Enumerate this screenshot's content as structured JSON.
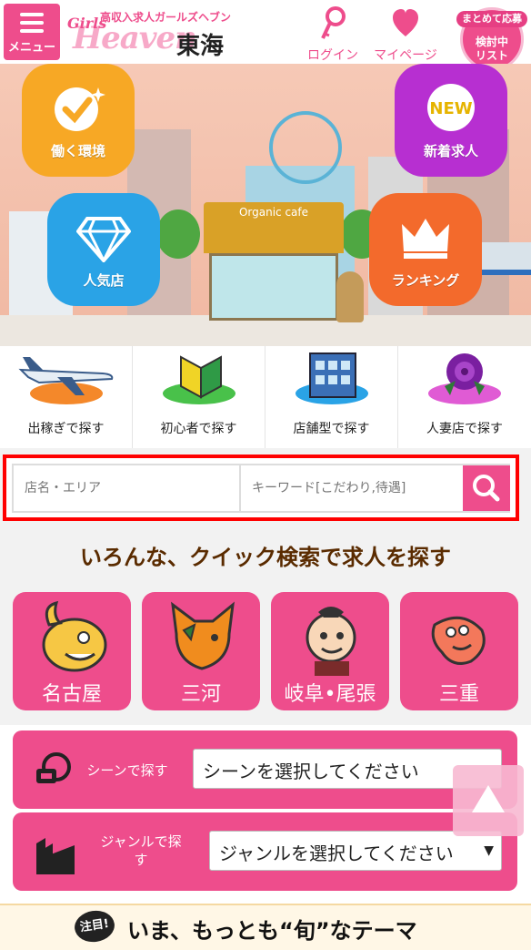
{
  "header": {
    "menu_label": "メニュー",
    "logo_sub": "高収入求人ガールズヘブン",
    "logo_girls": "Girls",
    "logo_main": "Heaven",
    "logo_region": "東海",
    "login_label": "ログイン",
    "mypage_label": "マイページ",
    "fav_top": "まとめて応募",
    "fav_line1": "検討中",
    "fav_line2": "リスト"
  },
  "hero": {
    "cafe_sign": "Organic cafe",
    "buttons": [
      "働く環境",
      "新着求人",
      "人気店",
      "ランキング"
    ],
    "new_badge": "NEW"
  },
  "categories": [
    "出稼ぎで探す",
    "初心者で探す",
    "店舗型で探す",
    "人妻店で探す"
  ],
  "search": {
    "area_placeholder": "店名・エリア",
    "keyword_placeholder": "キーワード[こだわり,待遇]"
  },
  "quick": {
    "title": "いろんな、クイック検索で求人を探す",
    "areas": [
      "名古屋",
      "三河",
      "岐阜•尾張",
      "三重"
    ]
  },
  "selects": {
    "scene_label": "シーンで探す",
    "scene_value": "シーンを選択してください",
    "genre_label_1": "ジャンルで探",
    "genre_label_2": "す",
    "genre_value": "ジャンルを選択してください",
    "arrow": "▼"
  },
  "theme": {
    "badge": "注目!",
    "text": "いま、もっとも“旬”なテーマ"
  },
  "colors": {
    "accent": "#ee4d8c",
    "highlight": "#ff0000"
  }
}
